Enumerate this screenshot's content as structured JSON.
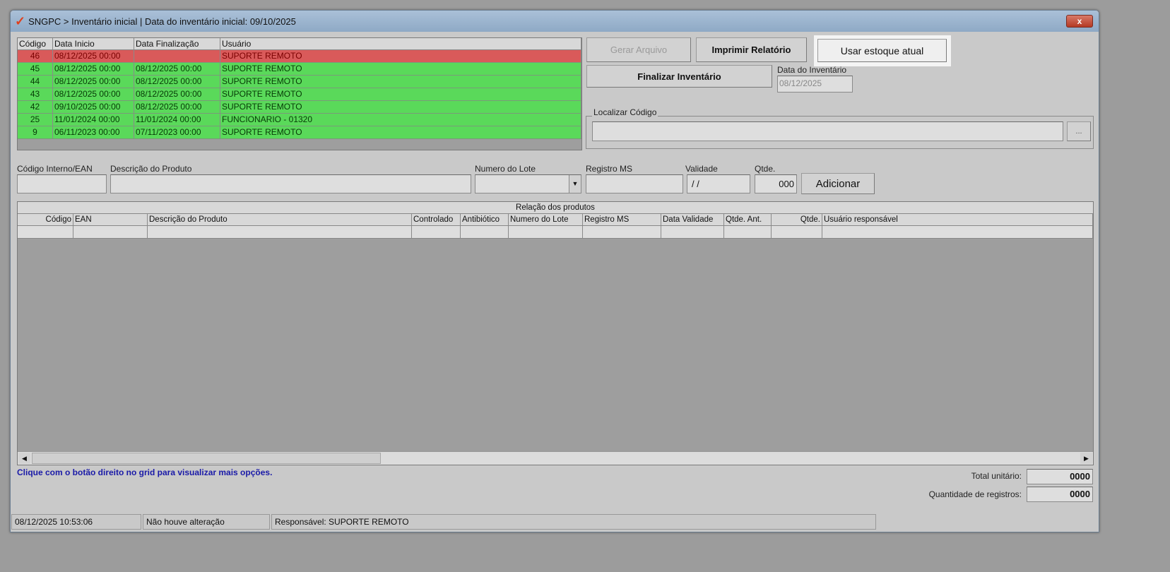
{
  "window": {
    "title": "SNGPC > Inventário inicial  |  Data do inventário inicial: 09/10/2025",
    "close": "x"
  },
  "inventories": {
    "columns": [
      "Código",
      "Data Inicio",
      "Data Finalização",
      "Usuário"
    ],
    "rows": [
      {
        "codigo": "46",
        "inicio": "08/12/2025 00:00",
        "fim": "",
        "usuario": "SUPORTE REMOTO",
        "status": "open"
      },
      {
        "codigo": "45",
        "inicio": "08/12/2025 00:00",
        "fim": "08/12/2025 00:00",
        "usuario": "SUPORTE REMOTO",
        "status": "closed"
      },
      {
        "codigo": "44",
        "inicio": "08/12/2025 00:00",
        "fim": "08/12/2025 00:00",
        "usuario": "SUPORTE REMOTO",
        "status": "closed"
      },
      {
        "codigo": "43",
        "inicio": "08/12/2025 00:00",
        "fim": "08/12/2025 00:00",
        "usuario": "SUPORTE REMOTO",
        "status": "closed"
      },
      {
        "codigo": "42",
        "inicio": "09/10/2025 00:00",
        "fim": "08/12/2025 00:00",
        "usuario": "SUPORTE REMOTO",
        "status": "closed"
      },
      {
        "codigo": "25",
        "inicio": "11/01/2024 00:00",
        "fim": "11/01/2024 00:00",
        "usuario": "FUNCIONARIO - 01320",
        "status": "closed"
      },
      {
        "codigo": "9",
        "inicio": "06/11/2023 00:00",
        "fim": "07/11/2023 00:00",
        "usuario": "SUPORTE REMOTO",
        "status": "closed"
      }
    ]
  },
  "buttons": {
    "gerar": "Gerar Arquivo",
    "imprimir": "Imprimir Relatório",
    "usar_estoque": "Usar estoque atual",
    "finalizar": "Finalizar Inventário",
    "adicionar": "Adicionar",
    "browse": "..."
  },
  "data_inventario": {
    "label": "Data do Inventário",
    "value": "08/12/2025"
  },
  "localizar": {
    "label": "Localizar Código",
    "value": ""
  },
  "form": {
    "codigo_label": "Código Interno/EAN",
    "descricao_label": "Descrição do Produto",
    "lote_label": "Numero do Lote",
    "registro_label": "Registro MS",
    "validade_label": "Validade",
    "validade_value": "/ /",
    "qtde_label": "Qtde.",
    "qtde_value": "000"
  },
  "products": {
    "caption": "Relação dos produtos",
    "columns": [
      "Código",
      "EAN",
      "Descrição do Produto",
      "Controlado",
      "Antibiótico",
      "Numero do Lote",
      "Registro MS",
      "Data Validade",
      "Qtde. Ant.",
      "Qtde.",
      "Usuário responsável"
    ]
  },
  "hint": "Clique com o botão direito no grid para visualizar mais opções.",
  "totals": {
    "total_label": "Total unitário:",
    "total_value": "0000",
    "qtd_label": "Quantidade de registros:",
    "qtd_value": "0000"
  },
  "status": {
    "datetime": "08/12/2025 10:53:06",
    "change": "Não houve alteração",
    "responsavel": "Responsável: SUPORTE REMOTO"
  },
  "colors": {
    "open_row": "#d95a5a",
    "closed_row": "#5ad95a",
    "hint": "#1a1aa8"
  }
}
